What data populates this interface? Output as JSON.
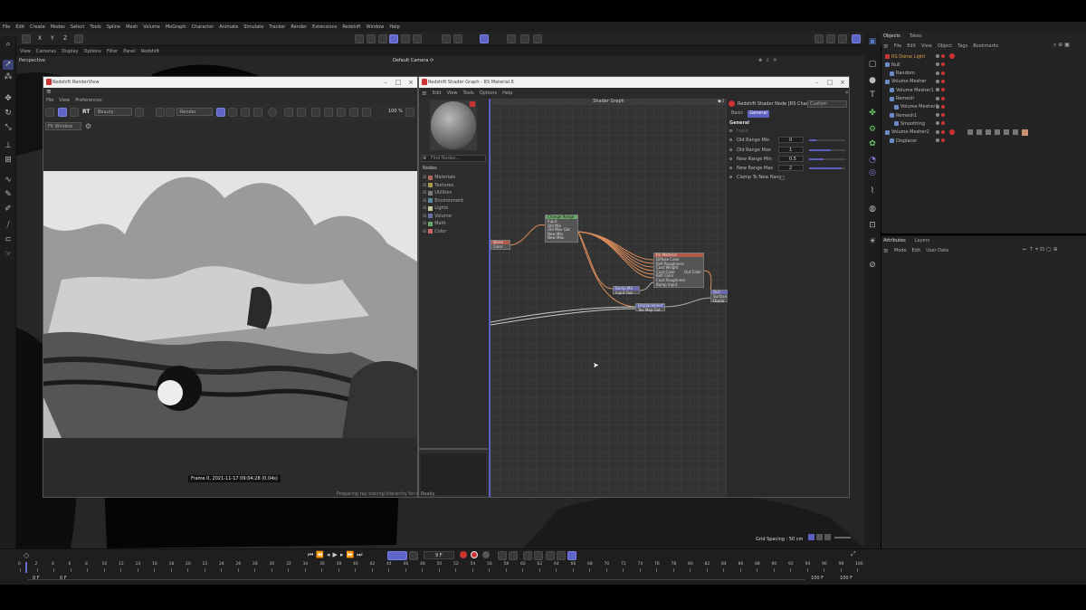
{
  "menubar": {
    "items": [
      "File",
      "Edit",
      "Create",
      "Modes",
      "Select",
      "Tools",
      "Spline",
      "Mesh",
      "Volume",
      "MoGraph",
      "Character",
      "Animate",
      "Simulate",
      "Tracker",
      "Render",
      "Extensions",
      "Redshift",
      "Window",
      "Help"
    ]
  },
  "toolbar": {
    "axes": [
      "X",
      "Y",
      "Z"
    ],
    "node_space": "Create",
    "node_space2": "Edit"
  },
  "viewport": {
    "menu": [
      "View",
      "Cameras",
      "Display",
      "Options",
      "Filter",
      "Panel",
      "Redshift"
    ],
    "label": "Perspective",
    "camera": "Default Camera ⟳"
  },
  "renderview": {
    "title": "Redshift RenderView",
    "menu": [
      "File",
      "View",
      "Preferences"
    ],
    "mode": "Beauty",
    "render_dropdown": "Render",
    "zoom": "100 %",
    "ipr": "RT",
    "fit": "Fit Window",
    "frame_info": "Frame 0,  2021-11-17  09:04:28  (0.04s)",
    "status": "Preparing ray tracing hierarchy for meshes"
  },
  "shadergraph": {
    "title": "Redshift Shader Graph - RS Material.6",
    "menu": [
      "Edit",
      "View",
      "Tools",
      "Options",
      "Help"
    ],
    "canvas_title": "Shader Graph",
    "find_placeholder": "Find Nodes...",
    "nodes_header": "Nodes",
    "categories": [
      {
        "label": "Materials",
        "color": "#b06a5a"
      },
      {
        "label": "Textures",
        "color": "#a89a55"
      },
      {
        "label": "Utilities",
        "color": "#7a7a7a"
      },
      {
        "label": "Environment",
        "color": "#5a8a9a"
      },
      {
        "label": "Lights",
        "color": "#c8c8a0"
      },
      {
        "label": "Volume",
        "color": "#6a6aa8"
      },
      {
        "label": "Math",
        "color": "#6aa86a"
      },
      {
        "label": "Color",
        "color": "#c86a6a"
      }
    ],
    "graph_nodes": {
      "color_node": {
        "title": "Noise",
        "port": "Color"
      },
      "change_range": {
        "title": "Change Range",
        "ports": [
          "Input",
          "Old Min",
          "Old Max Out",
          "New Min",
          "New Max"
        ]
      },
      "rs_material": {
        "title": "RS Material",
        "ports": [
          "Diffuse Color",
          "Refl Roughness",
          "Coat Weight",
          "Coat Color",
          "Refl Color",
          "Coat Roughness",
          "Bump Input"
        ],
        "out": "Out Color"
      },
      "bump": {
        "title": "Bump Ma",
        "port": "Input  Out"
      },
      "displacement": {
        "title": "Displacement",
        "port": "Tex Map Out"
      },
      "output": {
        "title": "Out",
        "ports": [
          "Surface",
          "Displa"
        ]
      }
    },
    "status": "Ready",
    "grid_spacing": "Grid Spacing : 50 cm"
  },
  "attr_panel": {
    "title": "Redshift Shader Node [RS Change Range]",
    "title_short": "Redshift Shader Node [RS Change",
    "preset": "Custom",
    "tabs": [
      "Basic",
      "General"
    ],
    "section": "General",
    "params": [
      {
        "label": "Input",
        "value": "",
        "fill": 0
      },
      {
        "label": "Old Range Min",
        "value": "0",
        "fill": 0.2
      },
      {
        "label": "Old Range Max",
        "value": "1",
        "fill": 0.6
      },
      {
        "label": "New Range Min",
        "value": "0.5",
        "fill": 0.4
      },
      {
        "label": "New Range Max",
        "value": "2",
        "fill": 0.9
      },
      {
        "label": "Clamp To New Range",
        "value": "",
        "fill": 0
      }
    ]
  },
  "objects": {
    "tabs": [
      "Objects",
      "Takes"
    ],
    "menu": [
      "File",
      "Edit",
      "View",
      "Object",
      "Tags",
      "Bookmarks"
    ],
    "items": [
      {
        "label": "RS Dome Light",
        "indent": 0,
        "color": "#d9a04a"
      },
      {
        "label": "Null",
        "indent": 0,
        "color": "#bbbbbb"
      },
      {
        "label": "Random",
        "indent": 1,
        "color": "#bbbbbb"
      },
      {
        "label": "Volume Mesher",
        "indent": 0,
        "color": "#bbbbbb"
      },
      {
        "label": "Volume Mesher1",
        "indent": 1,
        "color": "#bbbbbb"
      },
      {
        "label": "Remesh",
        "indent": 1,
        "color": "#bbbbbb"
      },
      {
        "label": "Volume Mesher2",
        "indent": 2,
        "color": "#bbbbbb"
      },
      {
        "label": "Remesh1",
        "indent": 1,
        "color": "#bbbbbb"
      },
      {
        "label": "Smoothing",
        "indent": 2,
        "color": "#bbbbbb"
      },
      {
        "label": "Volume Mesher2",
        "indent": 0,
        "color": "#bbbbbb"
      },
      {
        "label": "Displacer",
        "indent": 1,
        "color": "#bbbbbb"
      }
    ]
  },
  "attributes": {
    "tabs": [
      "Attributes",
      "Layers"
    ],
    "menu": [
      "Mode",
      "Edit",
      "User Data"
    ]
  },
  "timeline": {
    "frame": "9 F",
    "start": "0 F",
    "start2": "0 F",
    "end": "100 F",
    "end2": "100 F",
    "ticks": [
      "0",
      "2",
      "4",
      "6",
      "8",
      "10",
      "12",
      "14",
      "16",
      "18",
      "20",
      "22",
      "24",
      "26",
      "28",
      "30",
      "32",
      "34",
      "36",
      "38",
      "40",
      "42",
      "44",
      "46",
      "48",
      "50",
      "52",
      "54",
      "56",
      "58",
      "60",
      "62",
      "64",
      "66",
      "68",
      "70",
      "72",
      "74",
      "76",
      "78",
      "80",
      "82",
      "84",
      "86",
      "88",
      "90",
      "92",
      "94",
      "96",
      "98",
      "100"
    ]
  }
}
